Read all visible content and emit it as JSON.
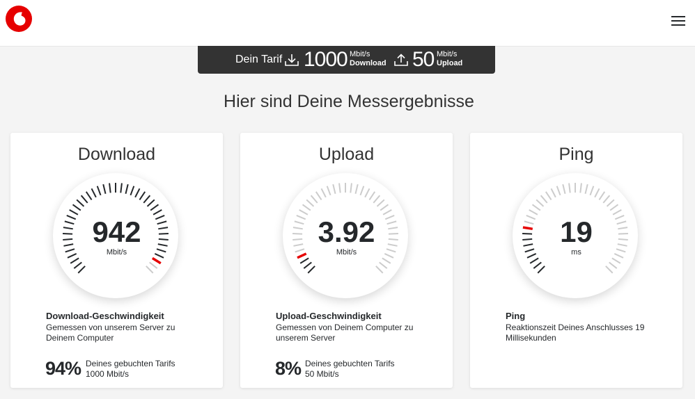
{
  "colors": {
    "brand_red": "#e60000",
    "tariff_bar": "#333333",
    "tick_grey": "#cccccc",
    "tick_dark": "#25282b"
  },
  "header": {
    "logo": "vodafone-logo",
    "menu_icon": "hamburger-menu-icon"
  },
  "tariff": {
    "label": "Dein Tarif",
    "download_value": "1000",
    "download_unit": "Mbit/s",
    "download_label": "Download",
    "upload_value": "50",
    "upload_unit": "Mbit/s",
    "upload_label": "Upload"
  },
  "headline": "Hier sind Deine Messergebnisse",
  "cards": [
    {
      "title": "Download",
      "value": "942",
      "unit": "Mbit/s",
      "gauge_fraction": 0.94,
      "desc_title": "Download-Geschwindigkeit",
      "desc_text": "Gemessen von unserem Server zu Deinem Computer",
      "percent": "94%",
      "percent_line1": "Deines gebuchten Tarifs",
      "percent_line2": "1000 Mbit/s"
    },
    {
      "title": "Upload",
      "value": "3.92",
      "unit": "Mbit/s",
      "gauge_fraction": 0.08,
      "desc_title": "Upload-Geschwindigkeit",
      "desc_text": "Gemessen von Deinem Computer zu unserem Server",
      "percent": "8%",
      "percent_line1": "Deines gebuchten Tarifs",
      "percent_line2": "50 Mbit/s"
    },
    {
      "title": "Ping",
      "value": "19",
      "unit": "ms",
      "gauge_fraction": 0.19,
      "desc_title": "Ping",
      "desc_text": "Reaktionszeit Deines Anschlusses 19 Millisekunden"
    }
  ]
}
